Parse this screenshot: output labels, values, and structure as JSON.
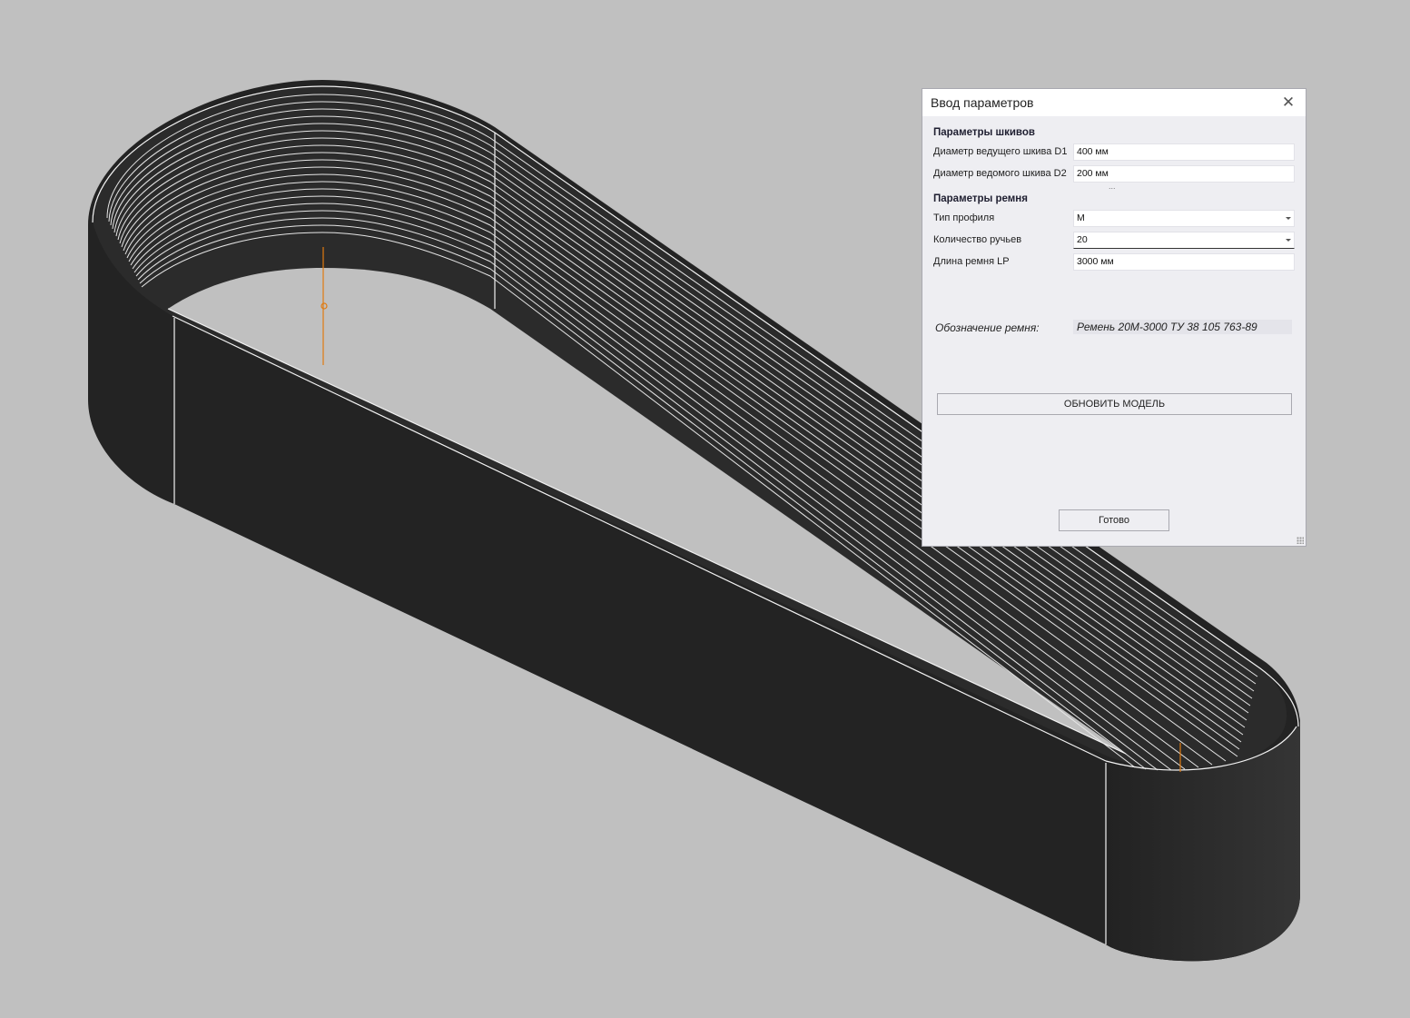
{
  "dialog": {
    "title": "Ввод параметров",
    "close_icon": "close-icon",
    "pulley_section": {
      "label": "Параметры шкивов",
      "d1_label": "Диаметр ведущего шкива D1",
      "d1_value": "400 мм",
      "d2_label": "Диаметр ведомого шкива D2",
      "d2_value": "200 мм",
      "more": "..."
    },
    "belt_section": {
      "label": "Параметры ремня",
      "profile_label": "Тип профиля",
      "profile_value": "M",
      "grooves_label": "Количество ручьев",
      "grooves_value": "20",
      "length_label": "Длина ремня LP",
      "length_value": "3000 мм"
    },
    "designation": {
      "label": "Обозначение ремня:",
      "value": "Ремень 20М-3000  ТУ 38 105 763-89"
    },
    "update_button": "ОБНОВИТЬ МОДЕЛЬ",
    "done_button": "Готово"
  },
  "viewport": {
    "background_color": "#c0c0c0",
    "model_color": "#232323",
    "axis_color": "#e07a10"
  }
}
